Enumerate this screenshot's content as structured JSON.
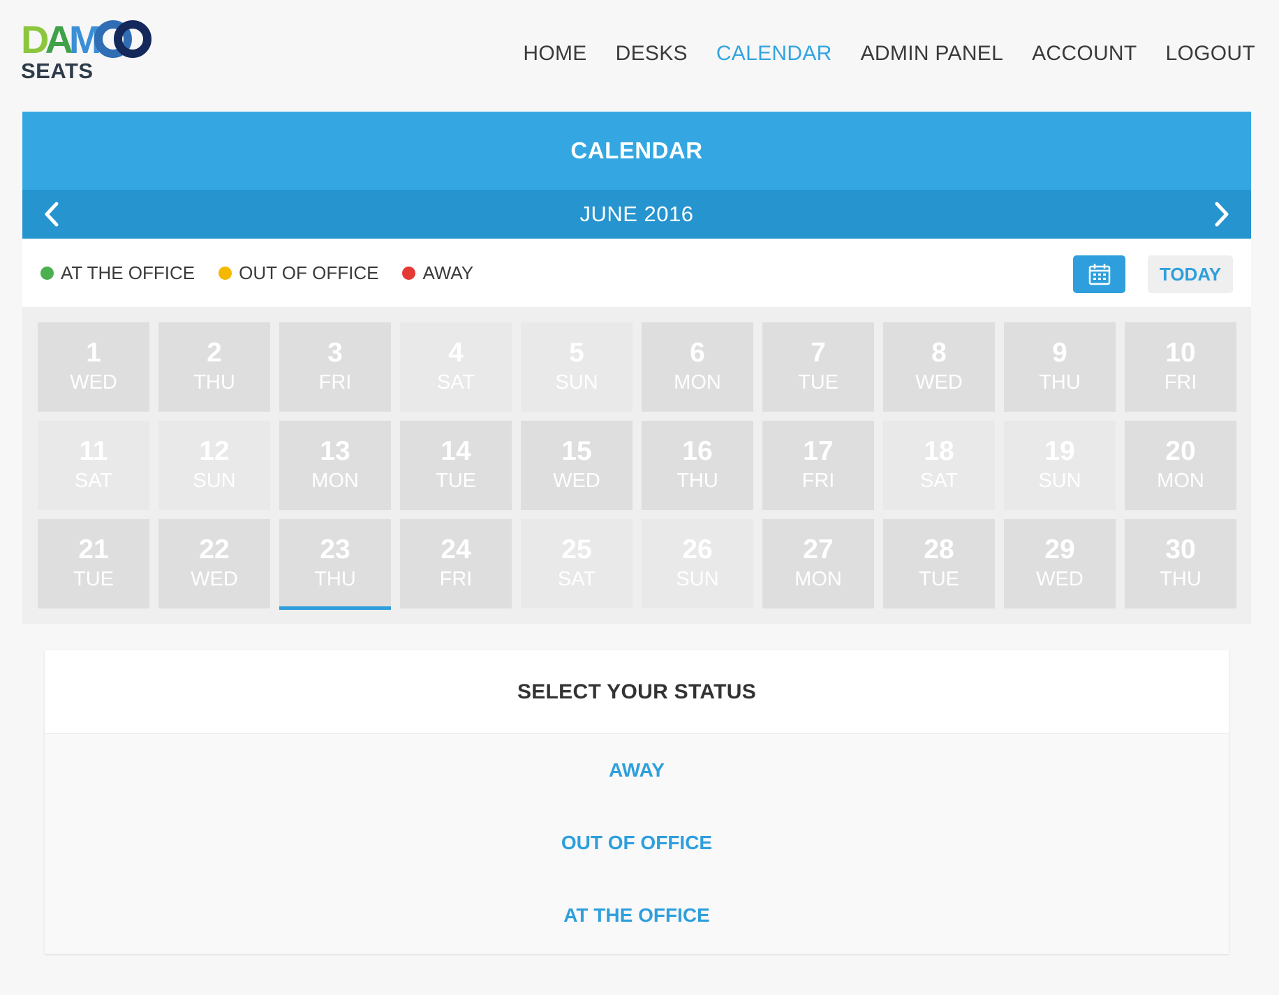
{
  "brand": {
    "logo_text": "DAMCO",
    "product": "SEATS"
  },
  "nav": {
    "items": [
      {
        "label": "HOME",
        "active": false
      },
      {
        "label": "DESKS",
        "active": false
      },
      {
        "label": "CALENDAR",
        "active": true
      },
      {
        "label": "ADMIN PANEL",
        "active": false
      },
      {
        "label": "ACCOUNT",
        "active": false
      },
      {
        "label": "LOGOUT",
        "active": false
      }
    ]
  },
  "calendar": {
    "title": "CALENDAR",
    "month": "JUNE 2016",
    "legend": [
      {
        "label": "AT THE OFFICE",
        "color": "#4caf50"
      },
      {
        "label": "OUT OF OFFICE",
        "color": "#f5b800"
      },
      {
        "label": "AWAY",
        "color": "#e53935"
      }
    ],
    "today_label": "TODAY",
    "days": [
      {
        "num": "1",
        "name": "WED"
      },
      {
        "num": "2",
        "name": "THU"
      },
      {
        "num": "3",
        "name": "FRI"
      },
      {
        "num": "4",
        "name": "SAT"
      },
      {
        "num": "5",
        "name": "SUN"
      },
      {
        "num": "6",
        "name": "MON"
      },
      {
        "num": "7",
        "name": "TUE"
      },
      {
        "num": "8",
        "name": "WED"
      },
      {
        "num": "9",
        "name": "THU"
      },
      {
        "num": "10",
        "name": "FRI"
      },
      {
        "num": "11",
        "name": "SAT"
      },
      {
        "num": "12",
        "name": "SUN"
      },
      {
        "num": "13",
        "name": "MON"
      },
      {
        "num": "14",
        "name": "TUE"
      },
      {
        "num": "15",
        "name": "WED"
      },
      {
        "num": "16",
        "name": "THU"
      },
      {
        "num": "17",
        "name": "FRI"
      },
      {
        "num": "18",
        "name": "SAT"
      },
      {
        "num": "19",
        "name": "SUN"
      },
      {
        "num": "20",
        "name": "MON"
      },
      {
        "num": "21",
        "name": "TUE"
      },
      {
        "num": "22",
        "name": "WED"
      },
      {
        "num": "23",
        "name": "THU"
      },
      {
        "num": "24",
        "name": "FRI"
      },
      {
        "num": "25",
        "name": "SAT"
      },
      {
        "num": "26",
        "name": "SUN"
      },
      {
        "num": "27",
        "name": "MON"
      },
      {
        "num": "28",
        "name": "TUE"
      },
      {
        "num": "29",
        "name": "WED"
      },
      {
        "num": "30",
        "name": "THU"
      }
    ],
    "selected_day": "23"
  },
  "status": {
    "title": "SELECT YOUR STATUS",
    "options": [
      "AWAY",
      "OUT OF OFFICE",
      "AT THE OFFICE"
    ]
  }
}
